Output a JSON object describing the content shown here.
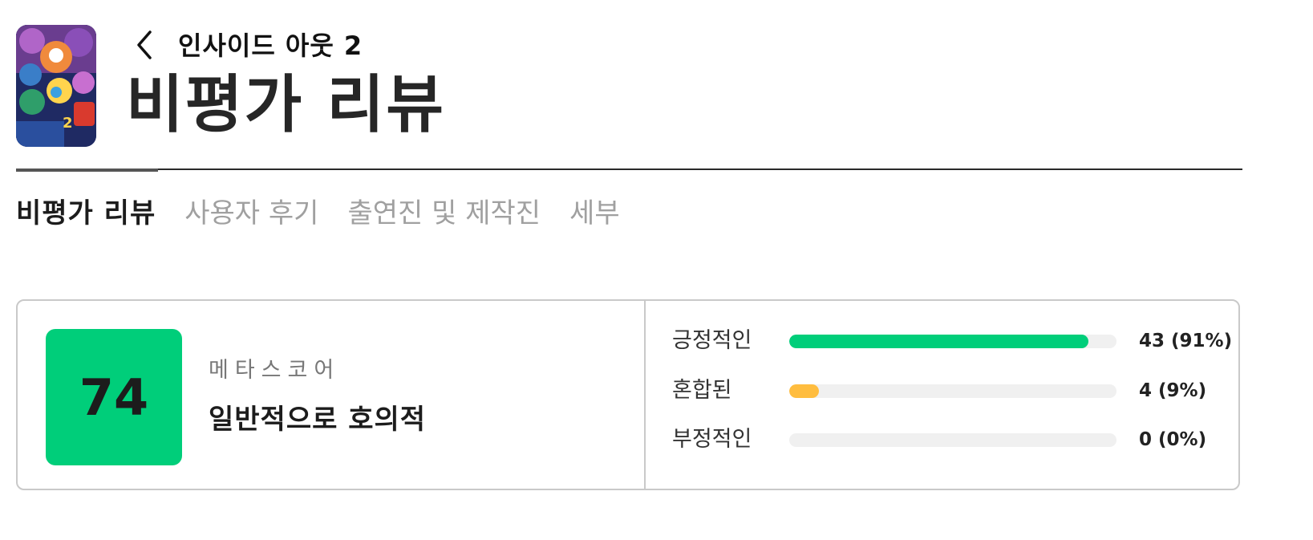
{
  "header": {
    "movie_title": "인사이드 아웃 2",
    "page_title": "비평가 리뷰",
    "back_icon": "chevron-left-icon",
    "poster_icon": "movie-poster"
  },
  "tabs": [
    {
      "label": "비평가 리뷰",
      "active": true
    },
    {
      "label": "사용자 후기",
      "active": false
    },
    {
      "label": "출연진 및 제작진",
      "active": false
    },
    {
      "label": "세부",
      "active": false
    }
  ],
  "score": {
    "value": "74",
    "label": "메타스코어",
    "description": "일반적으로 호의적",
    "color": "#00ce7a"
  },
  "distribution": [
    {
      "label": "긍정적인",
      "count_text": "43 (91%)",
      "fraction": 0.915,
      "color": "#00ce7a"
    },
    {
      "label": "혼합된",
      "count_text": "4 (9%)",
      "fraction": 0.09,
      "color": "#ffbd3f"
    },
    {
      "label": "부정적인",
      "count_text": "0 (0%)",
      "fraction": 0.0,
      "color": "#ff6874"
    }
  ],
  "colors": {
    "track": "#f0f0f0",
    "positive": "#00ce7a",
    "mixed": "#ffbd3f"
  }
}
